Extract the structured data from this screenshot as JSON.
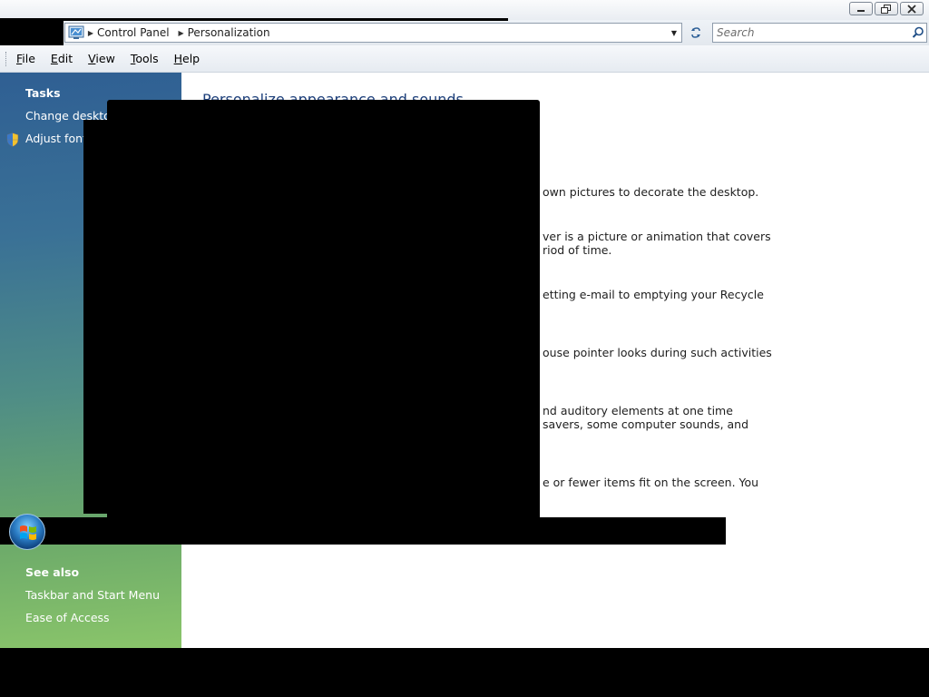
{
  "titlebar": {
    "minimize_label": "Minimize",
    "maximize_label": "Restore",
    "close_label": "Close"
  },
  "address": {
    "breadcrumbs": [
      "Control Panel",
      "Personalization"
    ]
  },
  "search": {
    "placeholder": "Search"
  },
  "menu": {
    "items": [
      {
        "key": "F",
        "rest": "ile"
      },
      {
        "key": "E",
        "rest": "dit"
      },
      {
        "key": "V",
        "rest": "iew"
      },
      {
        "key": "T",
        "rest": "ools"
      },
      {
        "key": "H",
        "rest": "elp"
      }
    ]
  },
  "sidebar": {
    "tasks_heading": "Tasks",
    "tasks": [
      "Change desktop",
      "Adjust font s"
    ],
    "see_also_heading": "See also",
    "see_also": [
      "Taskbar and Start Menu",
      "Ease of Access"
    ]
  },
  "main": {
    "title": "Personalize appearance and sounds",
    "desc_fragments": [
      "own pictures to decorate the desktop.",
      "ver is a picture or animation that covers",
      "riod of time.",
      "etting e-mail to emptying your Recycle",
      "ouse pointer looks during such activities",
      "nd auditory elements at one time",
      "savers, some computer sounds, and",
      "e or fewer items fit on the screen. You"
    ]
  },
  "colors": {
    "title_blue": "#1d3f7a",
    "pane_top": "#2f5f93",
    "pane_bottom": "#8ac56a"
  },
  "icons": [
    "control-panel-icon",
    "breadcrumb-arrow-icon",
    "dropdown-arrow-icon",
    "refresh-icon",
    "search-icon",
    "minimize-icon",
    "restore-icon",
    "close-icon",
    "uac-shield-icon",
    "windows-start-orb-icon"
  ]
}
